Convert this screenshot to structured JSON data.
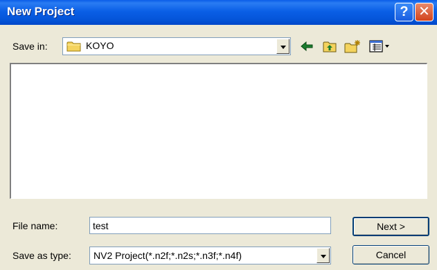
{
  "window": {
    "title": "New Project"
  },
  "titlebar": {
    "help_glyph": "?",
    "close_glyph": "✕"
  },
  "savein": {
    "label": "Save in:",
    "value": "KOYO"
  },
  "toolbar": {
    "icons": [
      "back-arrow-icon",
      "up-folder-icon",
      "new-folder-icon",
      "view-menu-icon"
    ]
  },
  "filename": {
    "label": "File name:",
    "value": "test"
  },
  "filetype": {
    "label": "Save as type:",
    "value": "NV2 Project(*.n2f;*.n2s;*.n3f;*.n4f)"
  },
  "buttons": {
    "next": "Next >",
    "cancel": "Cancel"
  },
  "colors": {
    "titlebar": "#0454d8",
    "dialog": "#ece9d8",
    "close": "#d2431c",
    "input_border": "#7f9db9"
  }
}
